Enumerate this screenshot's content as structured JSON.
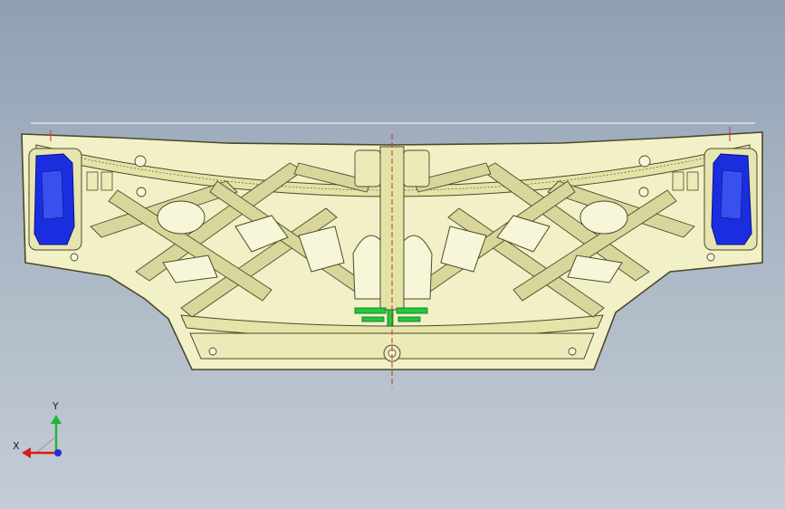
{
  "viewport": {
    "background_top": "#8fa0b4",
    "background_bottom": "#c4ccd6"
  },
  "model": {
    "panel_fill": "#f1f0c6",
    "panel_stroke": "#4a4a2a",
    "rib_fill": "#e4e3a8",
    "shade_fill": "#d8d69a",
    "highlight_blue": "#1a2ee0",
    "highlight_green": "#22c93a",
    "centerline_color": "#d0302a"
  },
  "triad": {
    "x_label": "X",
    "y_label": "Y",
    "x_color": "#d81b1b",
    "y_color": "#1fb83a",
    "z_color": "#2030d8"
  }
}
